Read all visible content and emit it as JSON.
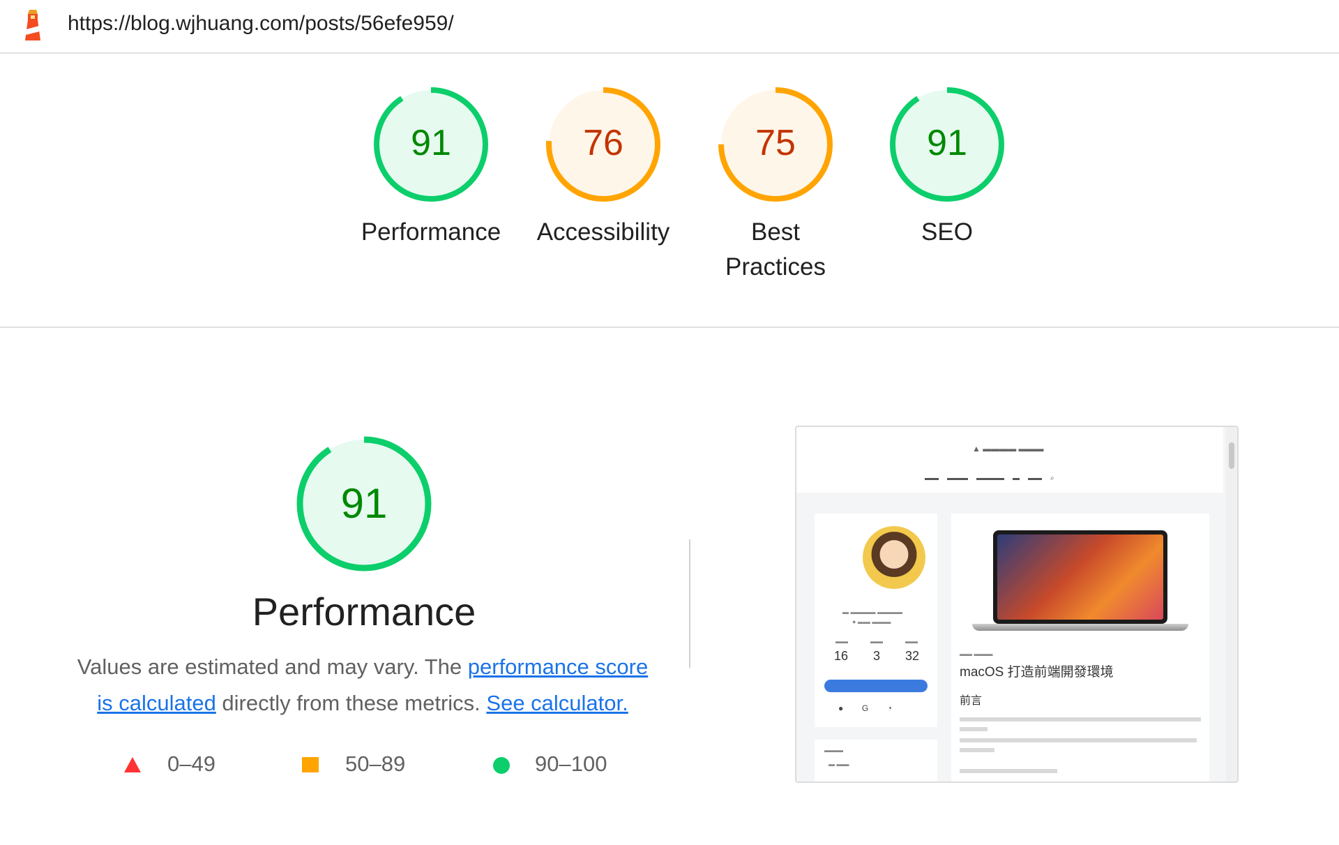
{
  "header": {
    "url": "https://blog.wjhuang.com/posts/56efe959/",
    "logo_icon": "lighthouse-icon"
  },
  "colors": {
    "pass": "#0cce6b",
    "pass_text": "#008800",
    "pass_bg": "#e6faf0",
    "average": "#ffa400",
    "average_text": "#c33300",
    "average_bg": "#fff6ea",
    "fail": "#ff3333",
    "link": "#1a73e8"
  },
  "gauges": [
    {
      "score": 91,
      "label": "Performance",
      "status": "pass"
    },
    {
      "score": 76,
      "label": "Accessibility",
      "status": "average"
    },
    {
      "score": 75,
      "label": "Best Practices",
      "status": "average"
    },
    {
      "score": 91,
      "label": "SEO",
      "status": "pass"
    }
  ],
  "performance": {
    "score": 91,
    "title": "Performance",
    "description_prefix": "Values are estimated and may vary. The ",
    "link_score": "performance score is calculated",
    "description_middle": " directly from these metrics. ",
    "link_calculator": "See calculator."
  },
  "legend": [
    {
      "range": "0–49",
      "shape": "triangle-icon",
      "status": "fail"
    },
    {
      "range": "50–89",
      "shape": "square-icon",
      "status": "average"
    },
    {
      "range": "90–100",
      "shape": "circle-icon",
      "status": "pass"
    }
  ],
  "screenshot": {
    "stats": [
      "16",
      "3",
      "32"
    ],
    "post_title": "macOS 打造前端開發環境",
    "section_heading": "前言"
  }
}
